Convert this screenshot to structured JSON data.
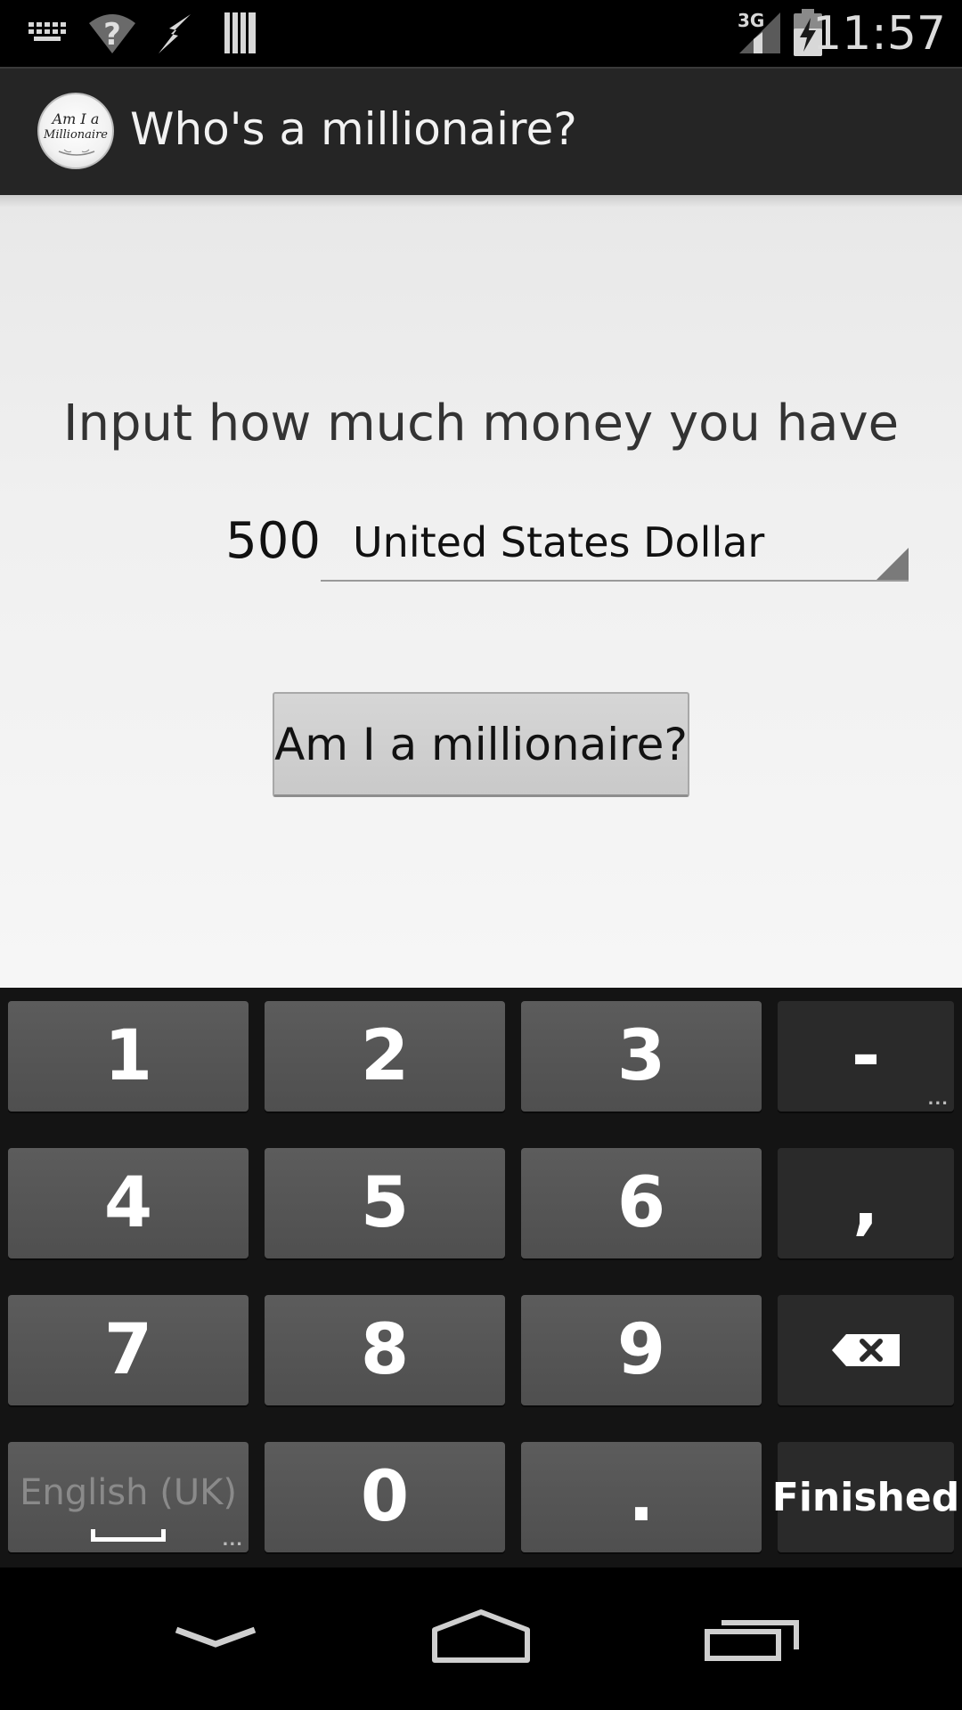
{
  "status_bar": {
    "network_type": "3G",
    "time": "11:57",
    "icons": [
      "keyboard-icon",
      "wifi-unknown-icon",
      "usb-debug-icon",
      "sd-card-icon",
      "signal-icon",
      "battery-charging-icon"
    ]
  },
  "action_bar": {
    "title": "Who's a millionaire?",
    "logo_line1": "Am I a",
    "logo_line2": "Millionaire"
  },
  "form": {
    "prompt": "Input how much money you have",
    "amount_value": "500",
    "currency_selected": "United States Dollar",
    "button_label": "Am I a millionaire?"
  },
  "keyboard": {
    "keys": {
      "k1": "1",
      "k2": "2",
      "k3": "3",
      "dash": "-",
      "k4": "4",
      "k5": "5",
      "k6": "6",
      "comma": ",",
      "k7": "7",
      "k8": "8",
      "k9": "9",
      "language": "English (UK)",
      "k0": "0",
      "period": ".",
      "done": "Finished"
    },
    "more_indicator": "..."
  },
  "nav_bar": {
    "icons": [
      "back-down-icon",
      "home-icon",
      "recent-apps-icon"
    ]
  },
  "colors": {
    "action_bar_bg": "#252525",
    "content_bg": "#f0f0f0",
    "keyboard_bg": "#141414",
    "number_key": "#555555",
    "function_key": "#2a2a2a",
    "button_bg": "#d0d0d0"
  }
}
